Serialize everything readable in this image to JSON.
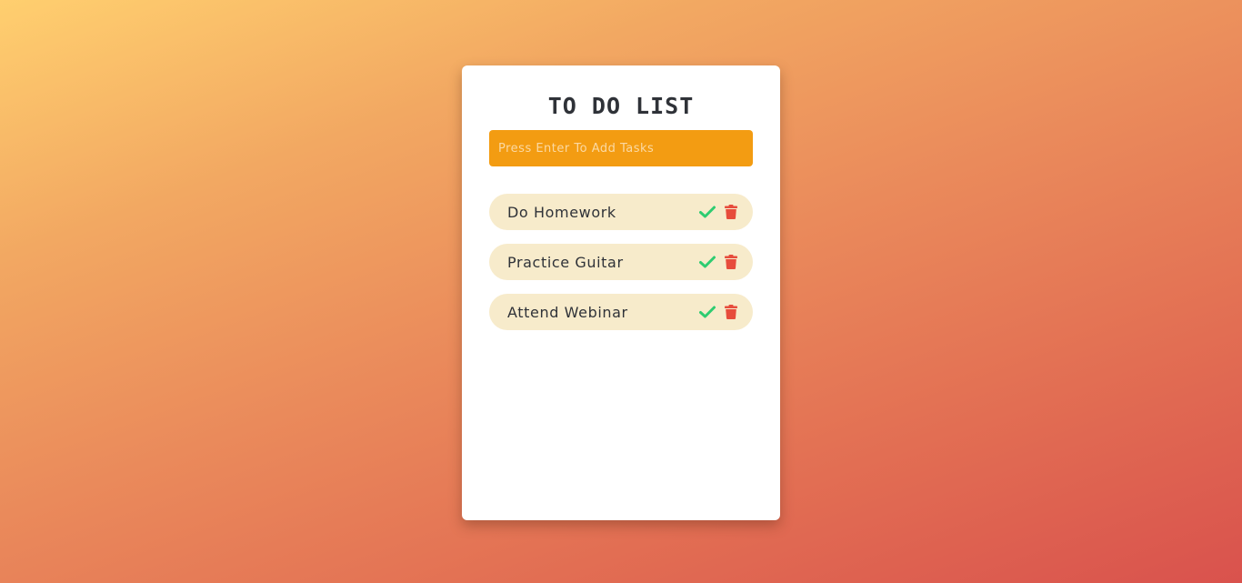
{
  "app": {
    "title": "TO DO LIST"
  },
  "input": {
    "placeholder": "Press Enter To Add Tasks",
    "value": ""
  },
  "tasks": [
    {
      "text": "Do Homework",
      "complete_icon": "check-icon",
      "delete_icon": "trash-icon"
    },
    {
      "text": "Practice Guitar",
      "complete_icon": "check-icon",
      "delete_icon": "trash-icon"
    },
    {
      "text": "Attend Webinar",
      "complete_icon": "check-icon",
      "delete_icon": "trash-icon"
    }
  ],
  "colors": {
    "accent": "#f39c12",
    "task_bg": "#f7ebcb",
    "check": "#2ecc71",
    "delete": "#e74c3c",
    "text": "#2f3238"
  }
}
